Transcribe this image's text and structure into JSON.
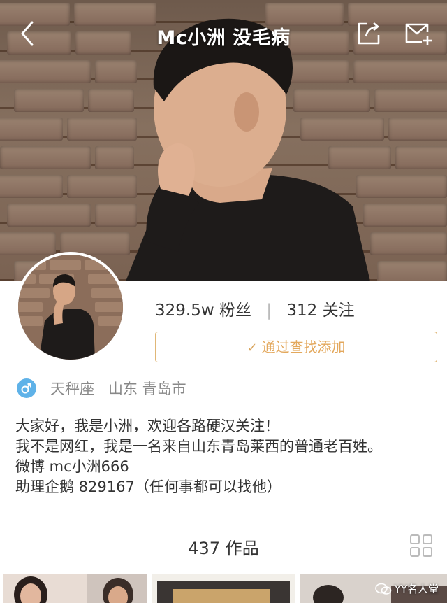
{
  "header": {
    "title": "Mc小洲 没毛病",
    "back_icon": "back-arrow-icon",
    "share_icon": "share-icon",
    "message_icon": "message-add-icon"
  },
  "profile": {
    "followers_count": "329.5w",
    "followers_label": "粉丝",
    "following_count": "312",
    "following_label": "关注",
    "add_button_label": "通过查找添加",
    "gender_icon": "male-icon",
    "zodiac": "天秤座",
    "location": "山东 青岛市"
  },
  "bio": {
    "line1": "大家好，我是小洲，欢迎各路硬汉关注！",
    "line2": "我不是网红，我是一名来自山东青岛莱西的普通老百姓。",
    "line3": "微博 mc小洲666",
    "line4": "助理企鹅 829167（任何事都可以找他）"
  },
  "works": {
    "count": "437",
    "label": "作品",
    "grid_icon": "grid-view-icon"
  },
  "watermark": {
    "text": "YY名人堂"
  },
  "colors": {
    "accent": "#e3a85d",
    "gender": "#5fb2e8"
  }
}
